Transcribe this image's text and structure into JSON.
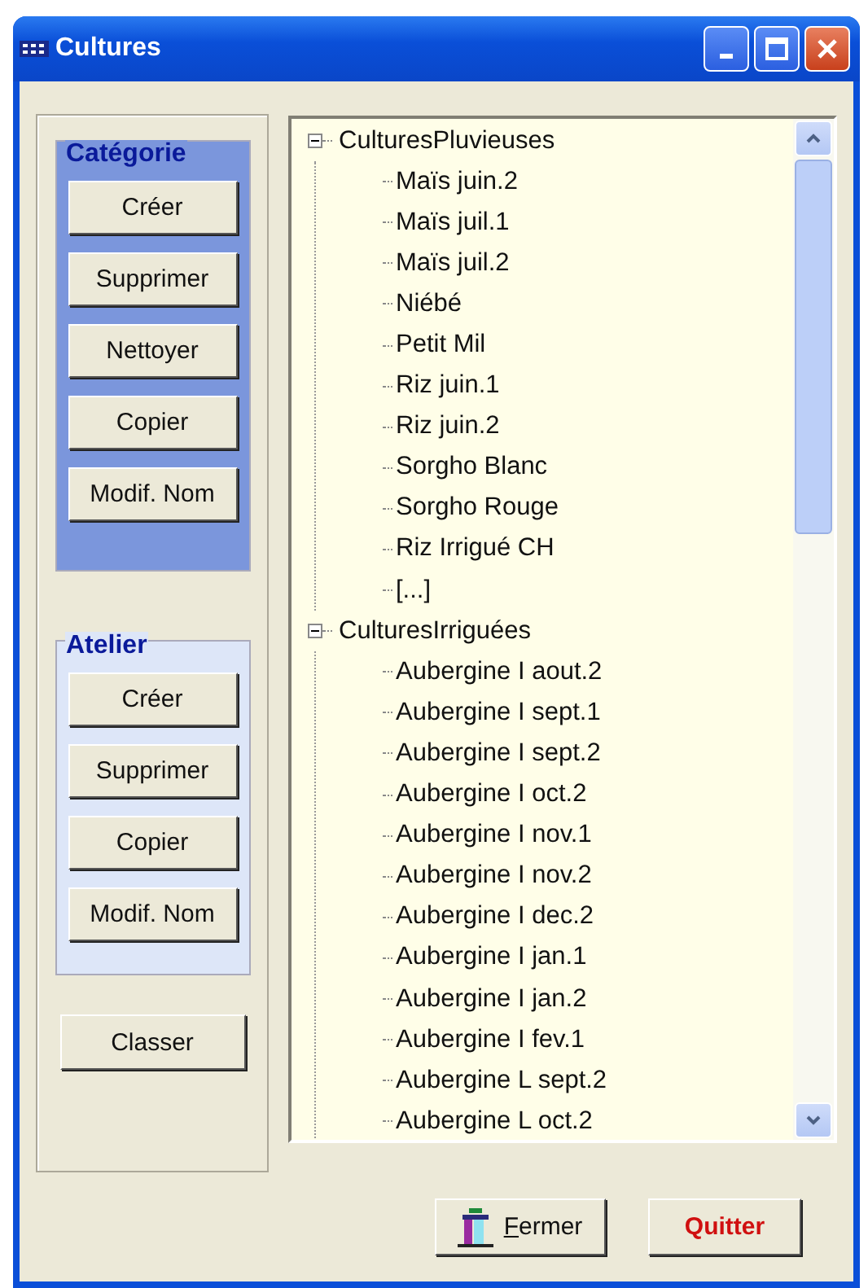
{
  "window": {
    "title": "Cultures"
  },
  "categorie": {
    "title": "Catégorie",
    "buttons": [
      "Créer",
      "Supprimer",
      "Nettoyer",
      "Copier",
      "Modif. Nom"
    ]
  },
  "atelier": {
    "title": "Atelier",
    "buttons": [
      "Créer",
      "Supprimer",
      "Copier",
      "Modif. Nom"
    ]
  },
  "classer_button": "Classer",
  "tree": [
    {
      "label": "CulturesPluvieuses",
      "expanded": true,
      "children": [
        {
          "label": "Maïs juin.2"
        },
        {
          "label": "Maïs juil.1"
        },
        {
          "label": "Maïs juil.2"
        },
        {
          "label": "Niébé"
        },
        {
          "label": "Petit Mil"
        },
        {
          "label": "Riz juin.1"
        },
        {
          "label": "Riz juin.2"
        },
        {
          "label": "Sorgho Blanc"
        },
        {
          "label": "Sorgho Rouge"
        },
        {
          "label": "Riz Irrigué CH"
        },
        {
          "label": "[...]"
        }
      ]
    },
    {
      "label": "CulturesIrriguées",
      "expanded": true,
      "children": [
        {
          "label": "Aubergine I aout.2"
        },
        {
          "label": "Aubergine I sept.1"
        },
        {
          "label": "Aubergine I sept.2"
        },
        {
          "label": "Aubergine I oct.2"
        },
        {
          "label": "Aubergine I nov.1"
        },
        {
          "label": "Aubergine I nov.2"
        },
        {
          "label": "Aubergine I dec.2"
        },
        {
          "label": "Aubergine I jan.1"
        },
        {
          "label": "Aubergine I jan.2"
        },
        {
          "label": "Aubergine I fev.1"
        },
        {
          "label": "Aubergine L sept.2"
        },
        {
          "label": "Aubergine L oct.2"
        }
      ]
    }
  ],
  "footer_buttons": [
    {
      "label": "Fermer",
      "kind": "close",
      "mnemonic": true
    },
    {
      "label": "Quitter",
      "kind": "quit",
      "mnemonic": false
    }
  ]
}
